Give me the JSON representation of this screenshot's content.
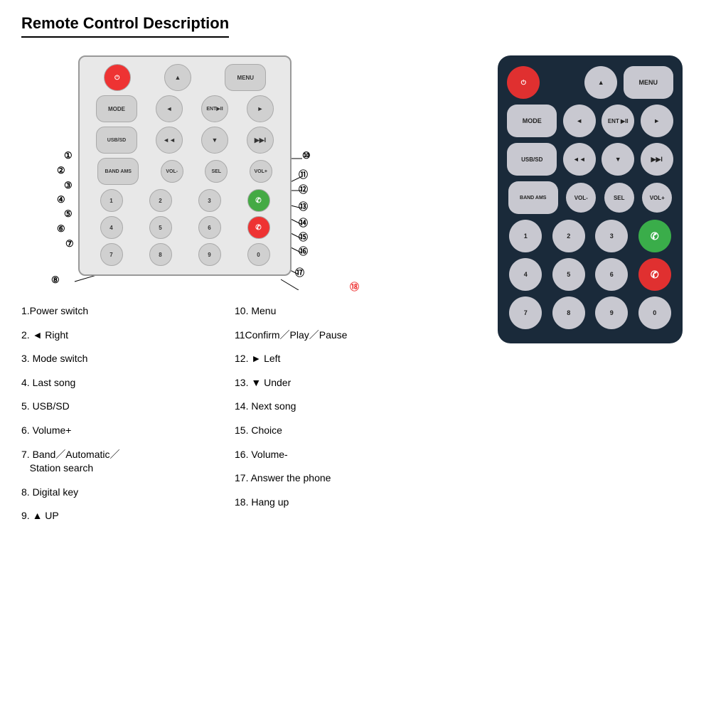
{
  "title": "Remote Control Description",
  "descriptions_left": [
    {
      "num": "1",
      "text": "1.Power switch"
    },
    {
      "num": "2",
      "text": "2. ◄ Right"
    },
    {
      "num": "3",
      "text": "3. Mode switch"
    },
    {
      "num": "4",
      "text": "4. Last song"
    },
    {
      "num": "5",
      "text": "5. USB/SD"
    },
    {
      "num": "6",
      "text": "6. Volume+"
    },
    {
      "num": "7",
      "text": "7. Band／Automatic／\n   Station search"
    },
    {
      "num": "8",
      "text": "8. Digital key"
    },
    {
      "num": "9",
      "text": "9. ▲ UP"
    }
  ],
  "descriptions_right": [
    {
      "num": "10",
      "text": "10. Menu"
    },
    {
      "num": "11",
      "text": "11Confirm／Play／Pause"
    },
    {
      "num": "12",
      "text": "12. ► Left"
    },
    {
      "num": "13",
      "text": "13. ▼ Under"
    },
    {
      "num": "14",
      "text": "14. Next song"
    },
    {
      "num": "15",
      "text": "15. Choice"
    },
    {
      "num": "16",
      "text": "16. Volume-"
    },
    {
      "num": "17",
      "text": "17. Answer the phone"
    },
    {
      "num": "18",
      "text": "18. Hang up"
    }
  ],
  "remote_rows": [
    [
      "POWER",
      "",
      "▲",
      "MENU"
    ],
    [
      "MODE",
      "◄",
      "ENT ▶II",
      "►"
    ],
    [
      "USB/SD",
      "◄◄",
      "▼",
      "▶▶I"
    ],
    [
      "BAND AMS",
      "VOL-",
      "SEL",
      "VOL+"
    ],
    [
      "1",
      "2",
      "3",
      "✆"
    ],
    [
      "4",
      "5",
      "6",
      "✆"
    ],
    [
      "7",
      "8",
      "9",
      "0"
    ]
  ]
}
